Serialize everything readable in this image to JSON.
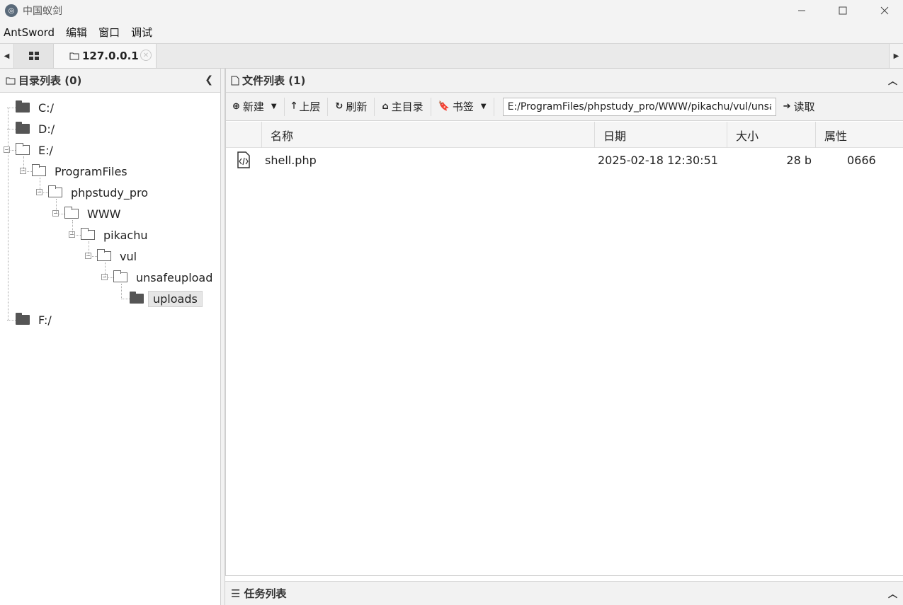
{
  "window": {
    "title": "中国蚁剑",
    "logo_icon": "antsword-logo-icon"
  },
  "menubar": {
    "items": [
      "AntSword",
      "编辑",
      "窗口",
      "调试"
    ]
  },
  "tabs": {
    "home_icon": "grid-icon",
    "active_label": "127.0.0.1",
    "close_icon": "close-circle-icon"
  },
  "dir_panel": {
    "title": "目录列表 (0)",
    "tree": [
      {
        "label": "C:/",
        "depth": 0,
        "expanded": false
      },
      {
        "label": "D:/",
        "depth": 0,
        "expanded": false
      },
      {
        "label": "E:/",
        "depth": 0,
        "expanded": true
      },
      {
        "label": "ProgramFiles",
        "depth": 1,
        "expanded": true
      },
      {
        "label": "phpstudy_pro",
        "depth": 2,
        "expanded": true
      },
      {
        "label": "WWW",
        "depth": 3,
        "expanded": true
      },
      {
        "label": "pikachu",
        "depth": 4,
        "expanded": true
      },
      {
        "label": "vul",
        "depth": 5,
        "expanded": true
      },
      {
        "label": "unsafeupload",
        "depth": 6,
        "expanded": true
      },
      {
        "label": "uploads",
        "depth": 7,
        "expanded": false,
        "selected": true
      },
      {
        "label": "F:/",
        "depth": 0,
        "expanded": false
      }
    ]
  },
  "file_panel": {
    "title": "文件列表 (1)",
    "toolbar": {
      "new_label": "新建",
      "up_label": "上层",
      "refresh_label": "刷新",
      "home_label": "主目录",
      "bookmark_label": "书签",
      "path_value": "E:/ProgramFiles/phpstudy_pro/WWW/pikachu/vul/unsafeupload/uploads/",
      "read_label": "读取"
    },
    "columns": [
      "名称",
      "日期",
      "大小",
      "属性"
    ],
    "rows": [
      {
        "name": "shell.php",
        "date": "2025-02-18 12:30:51",
        "size": "28 b",
        "perm": "0666"
      }
    ]
  },
  "task_panel": {
    "title": "任务列表"
  },
  "colors": {
    "panel_bg": "#f2f2f2",
    "border": "#cfcfcf",
    "selected_bg": "#e6e6e6"
  }
}
